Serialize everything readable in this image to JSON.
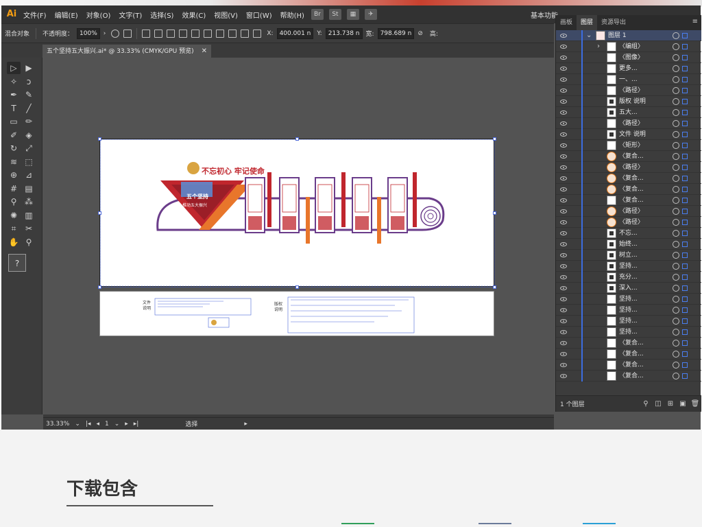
{
  "app": {
    "logo": "Ai"
  },
  "menu": [
    {
      "label": "文件(F)"
    },
    {
      "label": "编辑(E)"
    },
    {
      "label": "对象(O)"
    },
    {
      "label": "文字(T)"
    },
    {
      "label": "选择(S)"
    },
    {
      "label": "效果(C)"
    },
    {
      "label": "视图(V)"
    },
    {
      "label": "窗口(W)"
    },
    {
      "label": "帮助(H)"
    }
  ],
  "menu_icons": [
    "Br",
    "St"
  ],
  "workspace": "基本功能",
  "control": {
    "object_label": "混合对象",
    "opacity_label": "不透明度：",
    "opacity_value": "100%",
    "x_label": "X:",
    "x_value": "400.001 n",
    "y_label": "Y:",
    "y_value": "213.738 n",
    "w_label": "宽:",
    "w_value": "798.689 n",
    "h_label": "高:"
  },
  "document_tab": {
    "title": "五个坚持五大振兴.ai* @ 33.33% (CMYK/GPU 预览)",
    "close": "✕"
  },
  "tools": [
    {
      "name": "selection-tool",
      "glyph": "▷"
    },
    {
      "name": "direct-selection-tool",
      "glyph": "▶"
    },
    {
      "name": "magic-wand-tool",
      "glyph": "✧"
    },
    {
      "name": "lasso-tool",
      "glyph": "ↄ"
    },
    {
      "name": "pen-tool",
      "glyph": "✒"
    },
    {
      "name": "curvature-tool",
      "glyph": "✎"
    },
    {
      "name": "type-tool",
      "glyph": "T"
    },
    {
      "name": "line-tool",
      "glyph": "╱"
    },
    {
      "name": "rectangle-tool",
      "glyph": "▭"
    },
    {
      "name": "paintbrush-tool",
      "glyph": "✏"
    },
    {
      "name": "shaper-tool",
      "glyph": "✐"
    },
    {
      "name": "eraser-tool",
      "glyph": "◈"
    },
    {
      "name": "rotate-tool",
      "glyph": "↻"
    },
    {
      "name": "scale-tool",
      "glyph": "⤢"
    },
    {
      "name": "width-tool",
      "glyph": "≋"
    },
    {
      "name": "free-transform-tool",
      "glyph": "⬚"
    },
    {
      "name": "shape-builder-tool",
      "glyph": "⊕"
    },
    {
      "name": "perspective-tool",
      "glyph": "⊿"
    },
    {
      "name": "mesh-tool",
      "glyph": "#"
    },
    {
      "name": "gradient-tool",
      "glyph": "▤"
    },
    {
      "name": "eyedropper-tool",
      "glyph": "⚲"
    },
    {
      "name": "blend-tool",
      "glyph": "⁂"
    },
    {
      "name": "symbol-sprayer-tool",
      "glyph": "✺"
    },
    {
      "name": "column-graph-tool",
      "glyph": "▥"
    },
    {
      "name": "artboard-tool",
      "glyph": "⌗"
    },
    {
      "name": "slice-tool",
      "glyph": "✂"
    },
    {
      "name": "hand-tool",
      "glyph": "✋"
    },
    {
      "name": "zoom-tool",
      "glyph": "⚲"
    }
  ],
  "status": {
    "zoom": "33.33%",
    "page": "1",
    "mode": "选择"
  },
  "panel": {
    "tabs": [
      "画板",
      "图层",
      "资源导出"
    ],
    "footer": "1 个图层",
    "layers": [
      {
        "name": "图层 1",
        "thumb": "logo",
        "arrow": "⌄"
      },
      {
        "name": "〈编组〉",
        "thumb": "plain",
        "arrow": "›"
      },
      {
        "name": "〈图像〉",
        "thumb": "plain"
      },
      {
        "name": "更多...",
        "thumb": "plain"
      },
      {
        "name": "一、...",
        "thumb": "plain"
      },
      {
        "name": "〈路径〉",
        "thumb": "plain"
      },
      {
        "name": "版权 说明",
        "thumb": "dark"
      },
      {
        "name": "五大...",
        "thumb": "dark"
      },
      {
        "name": "〈路径〉",
        "thumb": "plain"
      },
      {
        "name": "文件 说明",
        "thumb": "dark"
      },
      {
        "name": "〈矩形〉",
        "thumb": "plain"
      },
      {
        "name": "〈复合...",
        "thumb": "orange"
      },
      {
        "name": "〈路径〉",
        "thumb": "orange"
      },
      {
        "name": "〈复合...",
        "thumb": "orange"
      },
      {
        "name": "〈复合...",
        "thumb": "orange"
      },
      {
        "name": "〈复合...",
        "thumb": "plain"
      },
      {
        "name": "〈路径〉",
        "thumb": "orange"
      },
      {
        "name": "〈路径〉",
        "thumb": "orange"
      },
      {
        "name": "不忘...",
        "thumb": "dark"
      },
      {
        "name": "始终...",
        "thumb": "dark"
      },
      {
        "name": "树立...",
        "thumb": "dark"
      },
      {
        "name": "坚持...",
        "thumb": "dark"
      },
      {
        "name": "充分...",
        "thumb": "dark"
      },
      {
        "name": "深入...",
        "thumb": "dark"
      },
      {
        "name": "坚持...",
        "thumb": "plain"
      },
      {
        "name": "坚持...",
        "thumb": "plain"
      },
      {
        "name": "坚持...",
        "thumb": "plain"
      },
      {
        "name": "坚持...",
        "thumb": "plain"
      },
      {
        "name": "〈复合...",
        "thumb": "plain"
      },
      {
        "name": "〈复合...",
        "thumb": "plain"
      },
      {
        "name": "〈复合...",
        "thumb": "plain"
      },
      {
        "name": "〈复合...",
        "thumb": "plain"
      }
    ]
  },
  "artwork": {
    "slogan": "不忘初心 牢记使命",
    "banner_title": "五个坚持",
    "banner_subtitle": "推动五大振兴",
    "notes_left": "文件\n说明",
    "notes_right": "版权\n说明"
  },
  "section": {
    "title": "下载包含"
  },
  "colors": {
    "accent_red": "#c0262d",
    "accent_orange": "#e8762b",
    "frame_blue": "#4a66d8",
    "purple": "#6a3c8a"
  }
}
